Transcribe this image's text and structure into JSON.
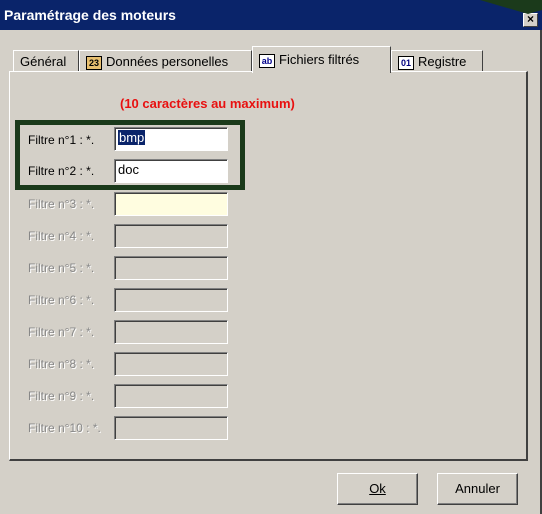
{
  "window": {
    "title": "Paramétrage des moteurs",
    "close_glyph": "×"
  },
  "tabs": [
    {
      "label": "Général",
      "icon": ""
    },
    {
      "label": "Données personelles",
      "icon": "person-card-icon"
    },
    {
      "label": "Fichiers filtrés",
      "icon": "ab-text-icon",
      "active": true
    },
    {
      "label": "Registre",
      "icon": "registry-icon"
    }
  ],
  "hint": "(10 caractères au maximum)",
  "filters": [
    {
      "label": "Filtre n°1 :",
      "prefix": "*.",
      "value": "bmp",
      "enabled": true
    },
    {
      "label": "Filtre n°2 :",
      "prefix": "*.",
      "value": "doc",
      "enabled": true
    },
    {
      "label": "Filtre n°3 :",
      "prefix": "*.",
      "value": "",
      "enabled": false
    },
    {
      "label": "Filtre n°4 :",
      "prefix": "*.",
      "value": "",
      "enabled": false
    },
    {
      "label": "Filtre n°5 :",
      "prefix": "*.",
      "value": "",
      "enabled": false
    },
    {
      "label": "Filtre n°6 :",
      "prefix": "*.",
      "value": "",
      "enabled": false
    },
    {
      "label": "Filtre n°7 :",
      "prefix": "*.",
      "value": "",
      "enabled": false
    },
    {
      "label": "Filtre n°8 :",
      "prefix": "*.",
      "value": "",
      "enabled": false
    },
    {
      "label": "Filtre n°9 :",
      "prefix": "*.",
      "value": "",
      "enabled": false
    },
    {
      "label": "Filtre n°10 :",
      "prefix": "*.",
      "value": "",
      "enabled": false
    }
  ],
  "buttons": {
    "ok": "Ok",
    "cancel": "Annuler"
  },
  "colors": {
    "title_bar": "#0a246a",
    "hint": "#e81010",
    "highlight_border": "#1b3a1b"
  }
}
